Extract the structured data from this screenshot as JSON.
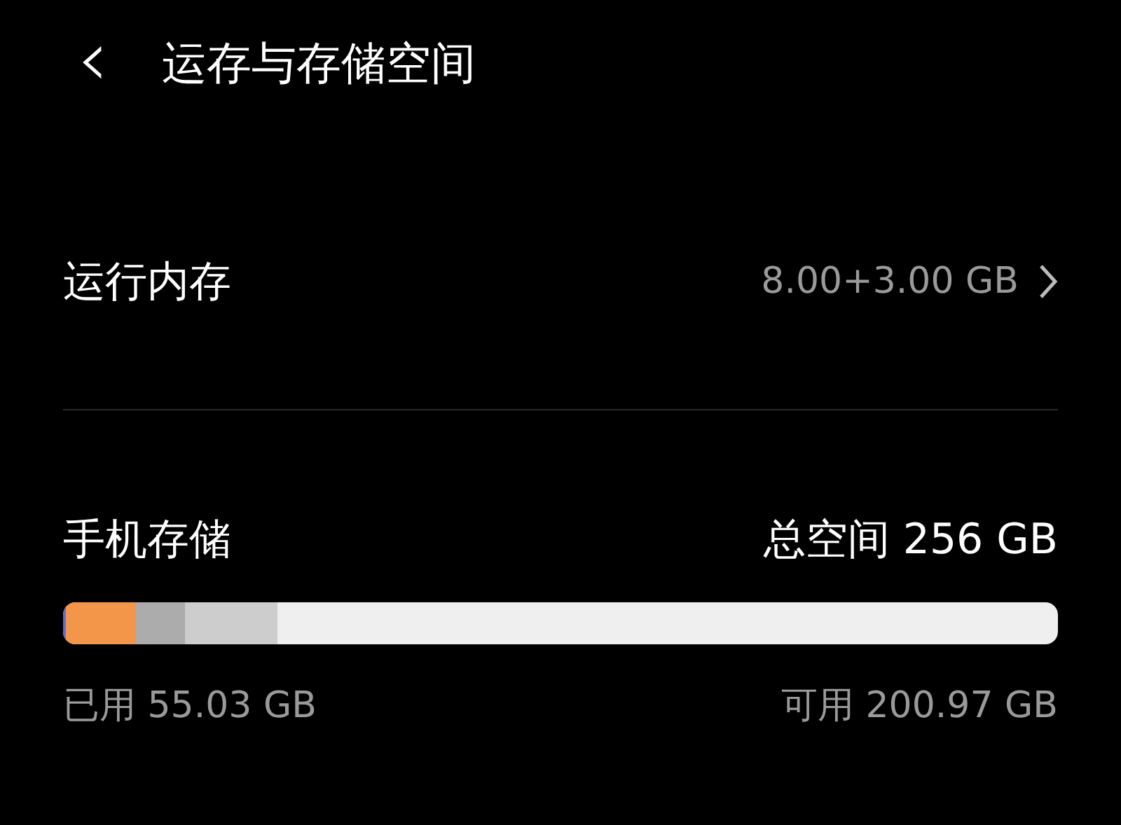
{
  "header": {
    "back_icon": "‹",
    "title": "运存与存储空间"
  },
  "memory": {
    "label": "运行内存",
    "value": "8.00+3.00 GB"
  },
  "storage": {
    "label": "手机存储",
    "total": "总空间 256 GB",
    "used": "已用 55.03 GB",
    "available": "可用 200.97 GB",
    "segments": [
      {
        "color": "#5b6fd8",
        "level": 0.003
      },
      {
        "color": "#f4964a",
        "level": 0.07
      },
      {
        "color": "#acacac",
        "level": 0.05
      },
      {
        "color": "#cdcdcd",
        "level": 0.092
      }
    ]
  }
}
